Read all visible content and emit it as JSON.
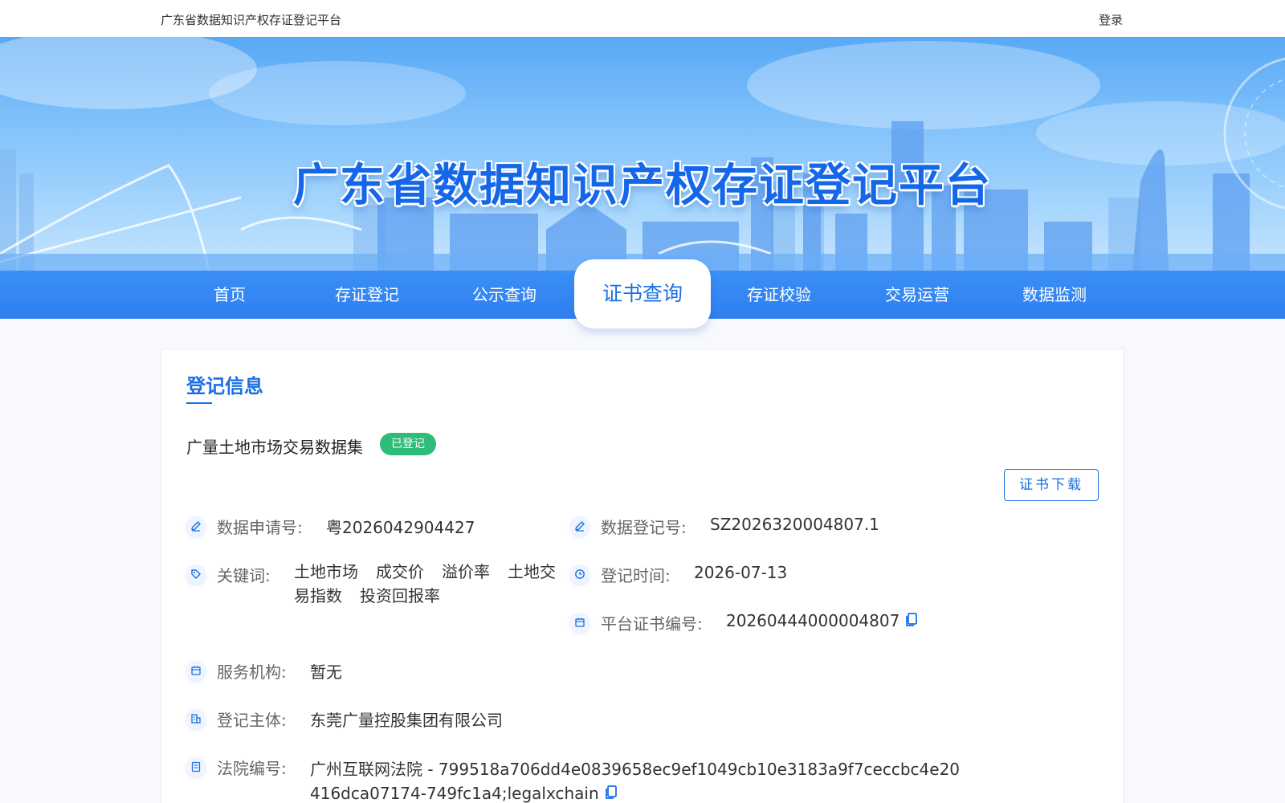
{
  "header": {
    "site_name": "广东省数据知识产权存证登记平台",
    "login_label": "登录"
  },
  "banner": {
    "title": "广东省数据知识产权存证登记平台"
  },
  "nav": {
    "items": [
      {
        "label": "首页"
      },
      {
        "label": "存证登记"
      },
      {
        "label": "公示查询"
      },
      {
        "label": "证书查询"
      },
      {
        "label": "存证校验"
      },
      {
        "label": "交易运营"
      },
      {
        "label": "数据监测"
      }
    ],
    "active_label": "证书查询"
  },
  "registration": {
    "section_title": "登记信息",
    "dataset_name": "广量土地市场交易数据集",
    "status": "已登记",
    "download_label": "证书下载",
    "application_no_label": "数据申请号:",
    "application_no": "粤2026042904427",
    "register_no_label": "数据登记号:",
    "register_no": "SZ2026320004807.1",
    "keywords_label": "关键词:",
    "keywords": [
      "土地市场",
      "成交价",
      "溢价率",
      "土地交易指数",
      "投资回报率"
    ],
    "register_time_label": "登记时间:",
    "register_time": "2026-07-13",
    "cert_no_label": "平台证书编号:",
    "cert_no": "20260444000004807",
    "service_org_label": "服务机构:",
    "service_org": "暂无",
    "subject_label": "登记主体:",
    "subject": "东莞广量控股集团有限公司",
    "court_label": "法院编号:",
    "court_name": "广州互联网法院",
    "court_code": " - 799518a706dd4e0839658ec9ef1049cb10e3183a9f7ceccbc4e20416dca07174-749fc1a4;legalxchain"
  },
  "colors": {
    "primary": "#1a6fe6",
    "nav_bg": "#3b8ff5",
    "status_green": "#2dbd78"
  }
}
